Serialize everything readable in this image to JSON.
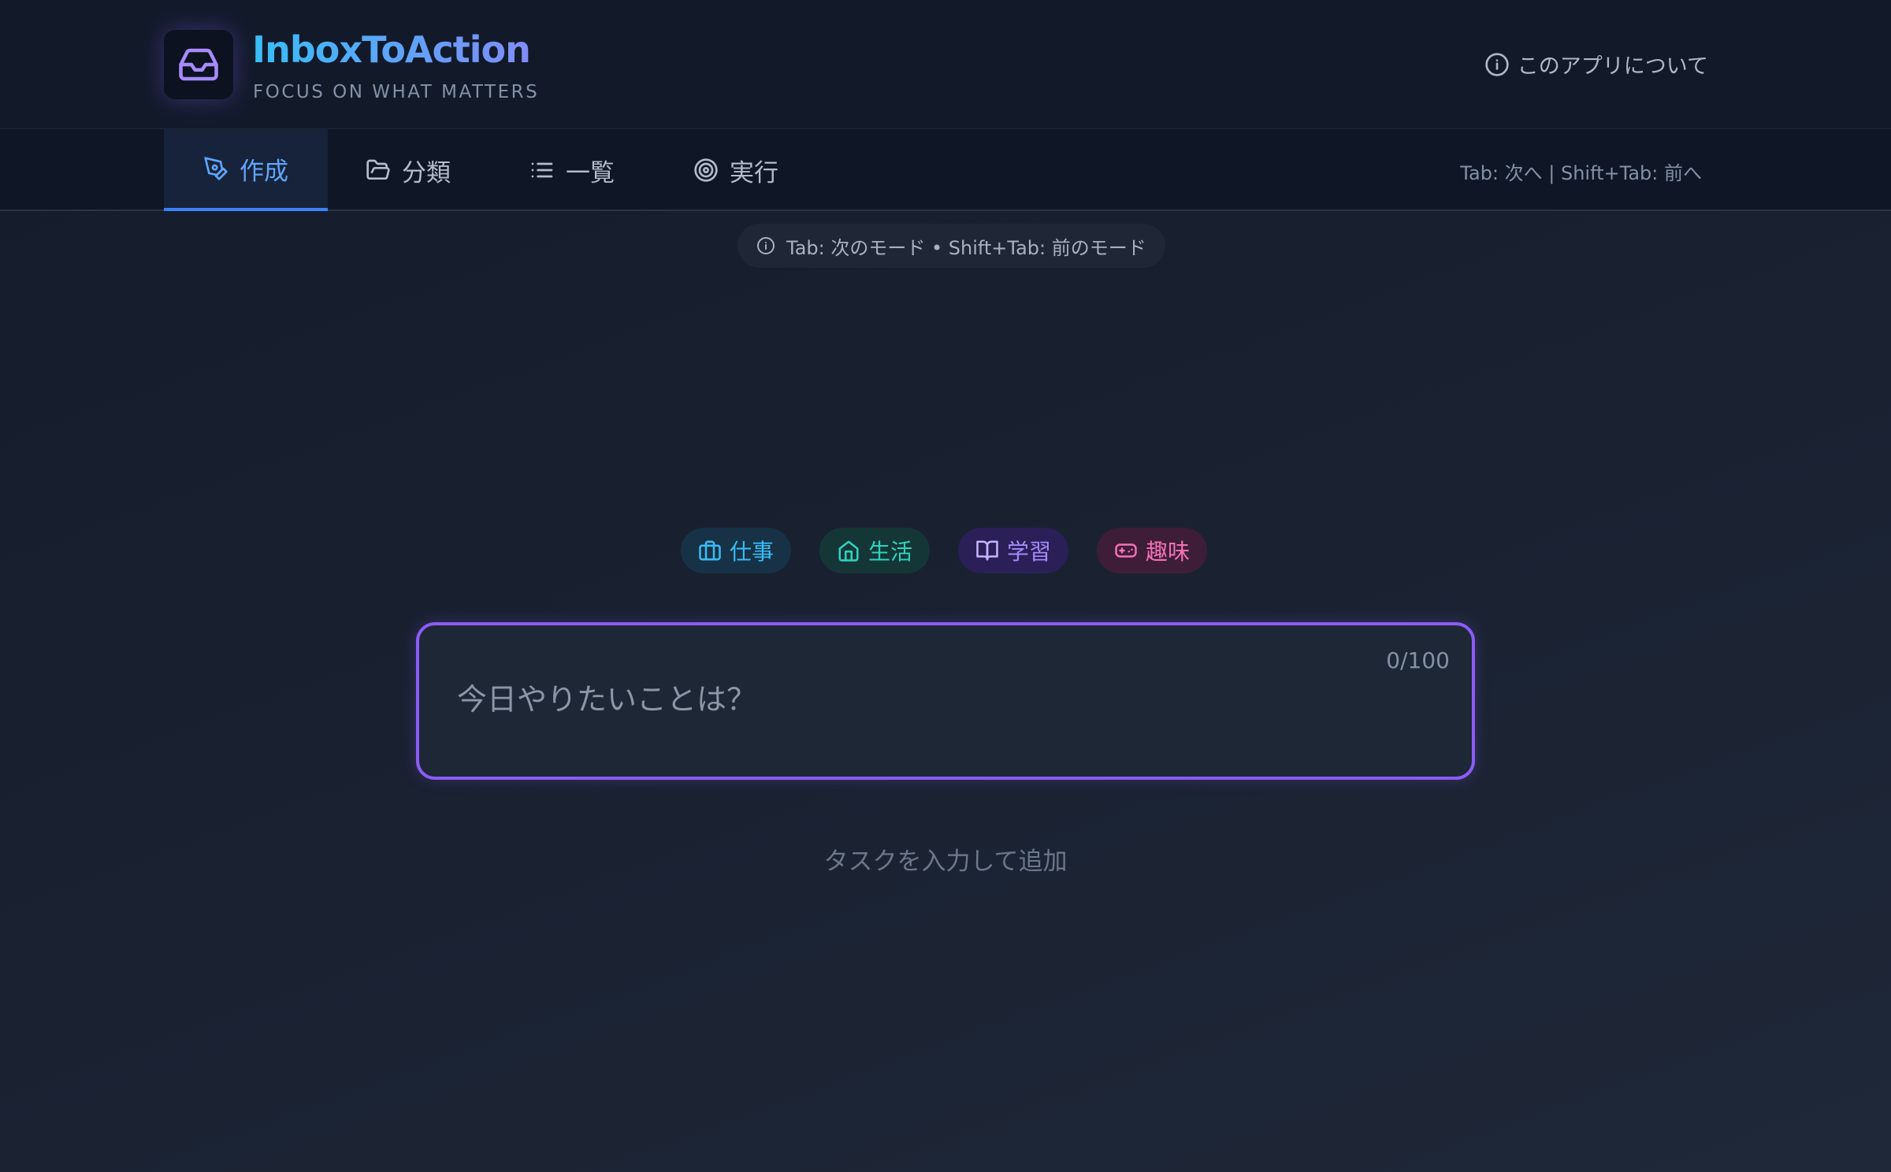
{
  "header": {
    "app_title": "InboxToAction",
    "app_subtitle": "FOCUS ON WHAT MATTERS",
    "about_label": "このアプリについて",
    "logo_icon": "inbox-icon"
  },
  "nav": {
    "tabs": [
      {
        "label": "作成",
        "icon": "pen-icon",
        "active": true
      },
      {
        "label": "分類",
        "icon": "folder-icon",
        "active": false
      },
      {
        "label": "一覧",
        "icon": "list-icon",
        "active": false
      },
      {
        "label": "実行",
        "icon": "target-icon",
        "active": false
      }
    ],
    "shortcut_hint": "Tab: 次へ | Shift+Tab: 前へ"
  },
  "mode_hint": "Tab: 次のモード • Shift+Tab: 前のモード",
  "categories": [
    {
      "label": "仕事",
      "icon": "briefcase-icon",
      "color": "#38bdf8"
    },
    {
      "label": "生活",
      "icon": "home-icon",
      "color": "#2dd4bf"
    },
    {
      "label": "学習",
      "icon": "book-icon",
      "color": "#a78bfa"
    },
    {
      "label": "趣味",
      "icon": "gamepad-icon",
      "color": "#f472b6"
    }
  ],
  "task_input": {
    "placeholder": "今日やりたいことは？",
    "value": "",
    "char_count": "0/100"
  },
  "add_hint": "タスクを入力して追加",
  "colors": {
    "accent": "#8b5cf6",
    "active_tab": "#60a5fa"
  }
}
